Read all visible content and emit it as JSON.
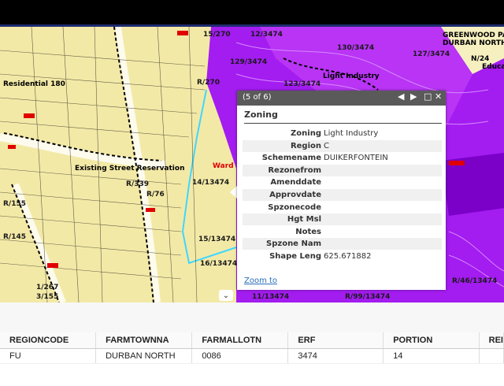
{
  "map": {
    "labels": {
      "residential": "Residential 180",
      "light_industry": "Light Industry",
      "street_reservation": "Existing Street Reservation",
      "greenwood": "GREENWOOD PARK",
      "durban_north": "DURBAN NORTH",
      "educa": "Educa",
      "ward": "Ward",
      "n24": "N/24",
      "lot_a": "15/270",
      "lot_b": "12/3474",
      "lot_c": "130/3474",
      "lot_d": "127/3474",
      "lot_e": "123/3474",
      "lot_f": "129/3474",
      "lot_g": "R/270",
      "lot_h": "14/13474",
      "lot_i": "15/13474",
      "lot_j": "16/13474",
      "lot_k": "R/46/13474",
      "lot_l": "R/99/13474",
      "lot_m": "11/13474",
      "lot_n": "R/339",
      "lot_o": "R/76",
      "lot_p": "R/155",
      "lot_q": "R/145",
      "lot_r": "1/267",
      "lot_s": "3/155"
    }
  },
  "popup": {
    "counter": "(5 of 6)",
    "title": "Zoning",
    "zoom_link": "Zoom to",
    "attributes": [
      {
        "key": "Zoning",
        "value": "Light Industry"
      },
      {
        "key": "Region",
        "value": "C"
      },
      {
        "key": "Schemename",
        "value": "DUIKERFONTEIN"
      },
      {
        "key": "Rezonefrom",
        "value": ""
      },
      {
        "key": "Amenddate",
        "value": ""
      },
      {
        "key": "Approvdate",
        "value": ""
      },
      {
        "key": "Spzonecode",
        "value": ""
      },
      {
        "key": "Hgt Msl",
        "value": ""
      },
      {
        "key": "Notes",
        "value": ""
      },
      {
        "key": "Spzone Nam",
        "value": ""
      },
      {
        "key": "Shape Leng",
        "value": "625.671882"
      }
    ]
  },
  "table": {
    "columns": [
      "REGIONCODE",
      "FARMTOWNNA",
      "FARMALLOTN",
      "ERF",
      "PORTION",
      "REI"
    ],
    "rows": [
      [
        "FU",
        "DURBAN NORTH",
        "0086",
        "3474",
        "14",
        ""
      ]
    ]
  },
  "colors": {
    "residential": "#f3e9a7",
    "industry": "#a31cf0",
    "industry_dark": "#7b00c8",
    "popup_header": "#5a5a5a",
    "link": "#2a6ebb"
  }
}
